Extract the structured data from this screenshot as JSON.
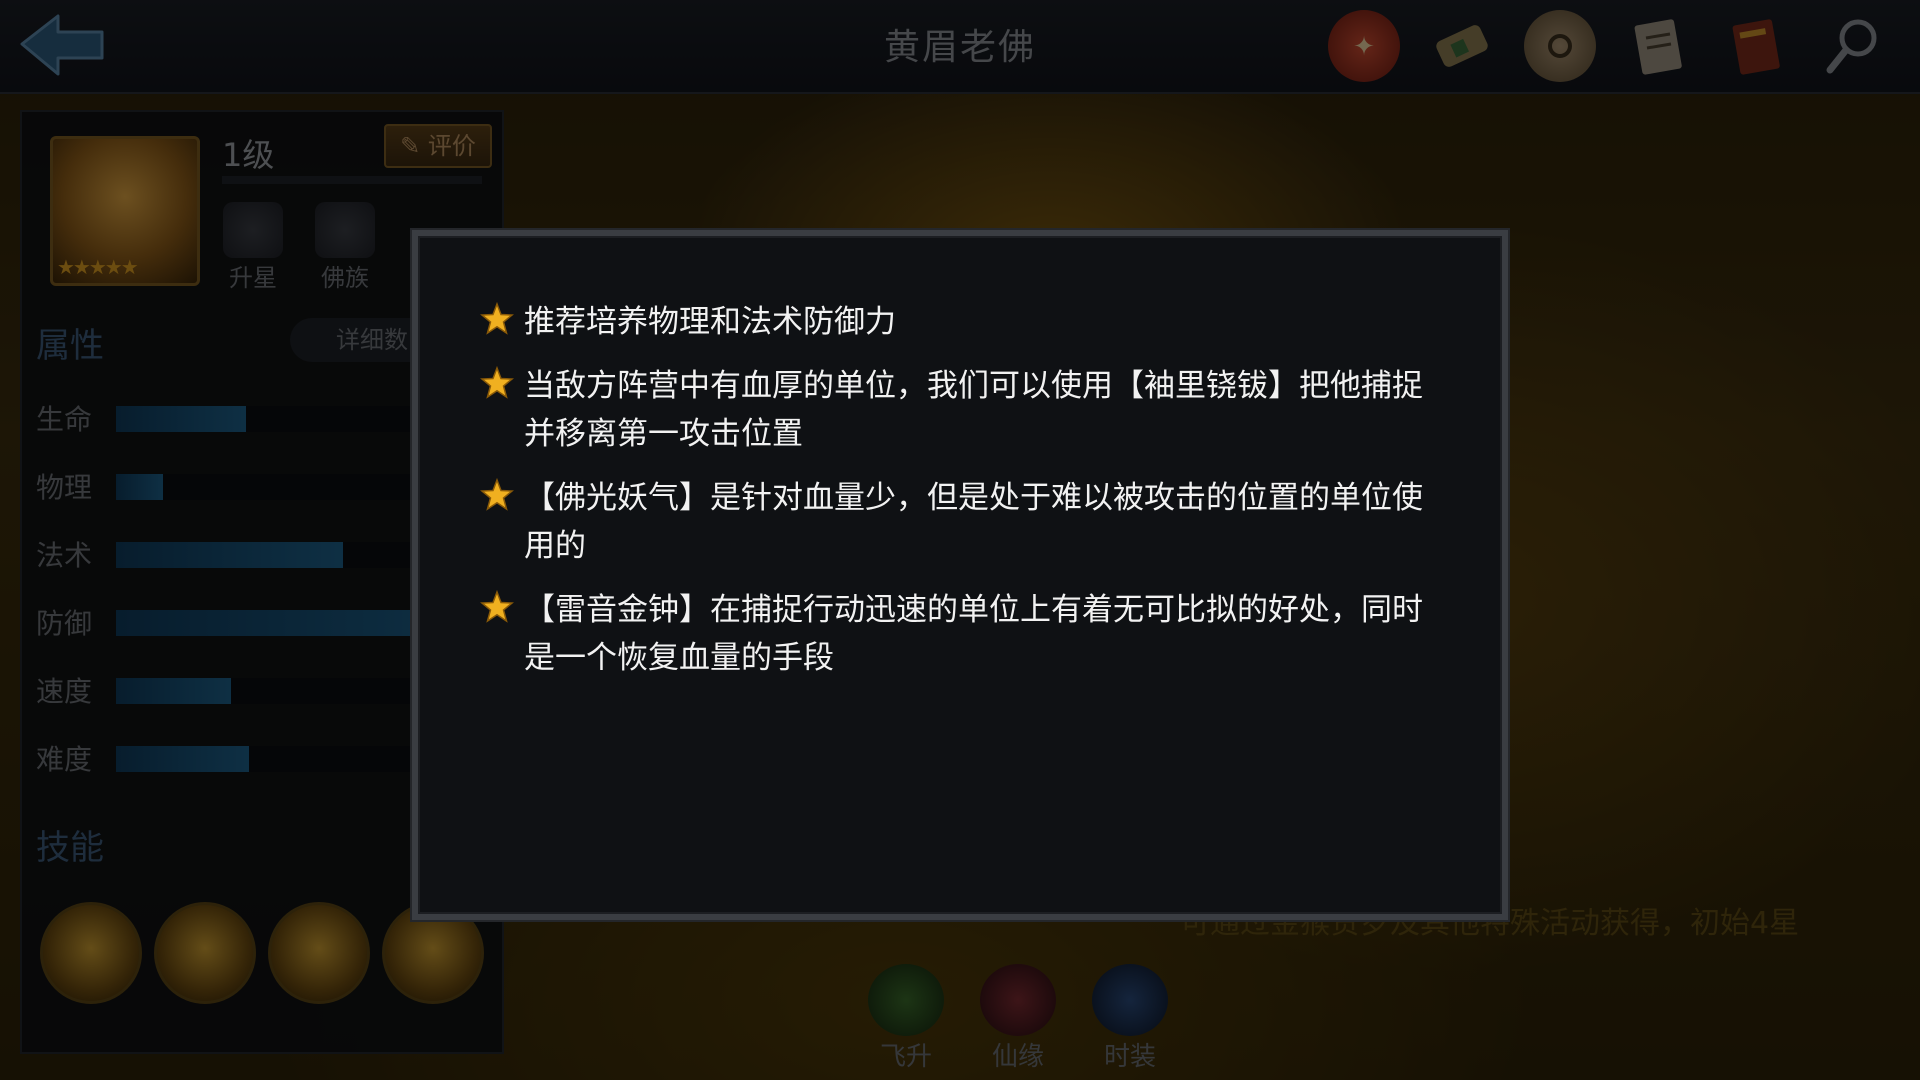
{
  "header": {
    "title": "黄眉老佛",
    "icons": [
      "trial-seal-icon",
      "scroll-icon",
      "jade-disc-icon",
      "document-icon",
      "book-icon",
      "magnifier-icon"
    ]
  },
  "hero": {
    "level": "1级",
    "rate_label": "评价",
    "stars": "★★★★★",
    "buttons": [
      "升星",
      "佛族"
    ]
  },
  "attributes": {
    "title": "属性",
    "detail_label": "详细数",
    "stats": [
      {
        "label": "生命",
        "value": 0.36
      },
      {
        "label": "物理",
        "value": 0.13
      },
      {
        "label": "法术",
        "value": 0.63
      },
      {
        "label": "防御",
        "value": 1.0
      },
      {
        "label": "速度",
        "value": 0.32
      },
      {
        "label": "难度",
        "value": 0.37
      }
    ]
  },
  "skills": {
    "title": "技能"
  },
  "bottom": {
    "buttons": [
      "飞升",
      "仙缘",
      "时装"
    ],
    "note": "可通过金猴贺岁及其他特殊活动获得，初始4星"
  },
  "modal": {
    "tips": [
      "推荐培养物理和法术防御力",
      "当敌方阵营中有血厚的单位，我们可以使用【袖里铙钹】把他捕捉并移离第一攻击位置",
      "【佛光妖气】是针对血量少，但是处于难以被攻击的位置的单位使用的",
      "【雷音金钟】在捕捉行动迅速的单位上有着无可比拟的好处，同时是一个恢复血量的手段"
    ]
  },
  "colors": {
    "accent_gold": "#f0b020",
    "bar_blue": "#1d5f88",
    "modal_bg": "#0f1114"
  }
}
